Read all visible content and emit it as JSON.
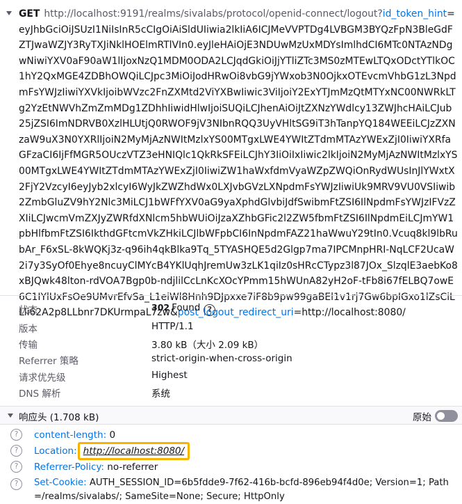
{
  "request": {
    "method": "GET",
    "url_base": "http://localhost:9191/realms/sivalabs/protocol/openid-connect/logout?",
    "param1_key": "id_token_hint",
    "param1_value": "eyJhbGciOiJSUzI1NiIsInR5cCIgOiAiSldUIiwia2lkIiA6ICJMeVVPTDg4LVBGM3BYQzFpN3BleGdFZTJwaWZJY3RyTXJiNklHOElmRTlVIn0.eyJleHAiOjE3NDUwMzUxMDYsImlhdCI6MTc0NTAzNDgwNiwiYXV0aF90aW1lIjoxNzQ1MDM0ODA2LCJqdGkiOiJjYTliZTc3MS0zMTEwLTQxODctYTlkOC1hY2QxMGE4ZDBhOWQiLCJpc3MiOiJodHRwOi8vbG9jYWxob3N0OjkxOTEvcmVhbG1zL3NpdmFsYWJzIiwiYXVkIjoibWVzc2FnZXMtd2ViYXBwIiwic3ViIjoiY2ExYTJmMzQtMTYxNC00NWRkLTg2YzEtNWVhZmZmMDg1ZDhhIiwidHlwIjoiSUQiLCJhenAiOiJtZXNzYWdlcy13ZWJhcHAiLCJub25jZSI6ImNDRVB0XzlHLUtjQ0RWOF9jV3NIbnRQQ3UyVHltSG9iT3hTanpYQ184WEEiLCJzZXNzaW9uX3N0YXRlIjoiN2MyMjAzNWItMzlxYS00MTgxLWE4YWItZTdmMTAzYWExZjI0IiwiYXRfaGFzaCI6IjFfMGR5OUczVTZ3eHNIQlc1QkRkSFEiLCJhY3IiOiIxIiwic2lkIjoiN2MyMjAzNWItMzlxYS00MTgxLWE4YWItZTdmMTAzYWExZjI0IiwiZW1haWxfdmVyaWZpZWQiOnRydWUsInJlYWxtX2FjY2VzcyI6eyJyb2xlcyI6WyJkZWZhdWx0LXJvbGVzLXNpdmFsYWJzIiwiUk9MRV9VU0VSIiwib2ZmbGluZV9hY2Nlc3MiLCJ1bWFfYXV0aG9yaXphdGlvbiJdfSwibmFtZSI6IlNpdmFsYWJzIFVzZXIiLCJwcmVmZXJyZWRfdXNlcm5hbWUiOiJzaXZhbGFic2l2ZW5fbmFtZSI6IlNpdmEiLCJmYW1pbHlfbmFtZSI6IkthdGFtcmVkZHkiLCJlbWFpbCI6InNpdmFAZ21haWwuY29tIn0.Vcuq8kl9lbRubAr_F6xSL-8kWQKj3z-q96ih4qkBlka9Tq_5TYASHQE5d2Glgp7ma7IPCMnpHRI-NqLCF2UcaW2i7y3SyOf0Ehye8ncuyClMYcB4YKlUqhJremUw3zLK1qiIz0sHRcCTypz3l87JOx_SlzqlE3aebKo8xBJQwk48lton-rdVOA7Bgp0b-ndjlilCcLnKcXOcYPmm15hWUnA82yH2oF-tFb8i67fELBQ7owE6C1IYlUxFsOe9UMvrEfvSa_L1eiWl8Hnh9DJpxxe7iF8b9pw99gaBEl1v1rj7Gw6bpIGxo1lZsCiLLli62A2p8LLbnr7DKUrmpaL7zw",
    "param_sep": "&",
    "param2_key": "post_logout_redirect_uri",
    "param2_value": "=http://localhost:8080/"
  },
  "summary": [
    {
      "label": "状态",
      "value": "Found",
      "status_code": "302",
      "help": "?"
    },
    {
      "label": "版本",
      "value": "HTTP/1.1"
    },
    {
      "label": "传输",
      "value": "3.80 kB（大小 2.09 kB）"
    },
    {
      "label": "Referrer 策略",
      "value": "strict-origin-when-cross-origin"
    },
    {
      "label": "请求优先级",
      "value": "Highest"
    },
    {
      "label": "DNS 解析",
      "value": "系统"
    }
  ],
  "response_headers": {
    "title": "响应头 (1.708 kB)",
    "raw_label": "原始",
    "raw_enabled": false,
    "help_glyph": "?",
    "items": [
      {
        "name": "content-length:",
        "value": "0"
      },
      {
        "name": "Location:",
        "value": "http://localhost:8080/"
      },
      {
        "name": "Referrer-Policy:",
        "value": "no-referrer"
      },
      {
        "name": "Set-Cookie:",
        "value": "AUTH_SESSION_ID=6b5fdde9-7f62-416b-bcfd-896eb94f4d0e; Version=1; Path=/realms/sivalabs/; SameSite=None; Secure; HttpOnly"
      }
    ]
  },
  "colors": {
    "header_name": "#0074e8",
    "highlight_border": "#f6b400",
    "muted_label": "#5b5b66"
  }
}
